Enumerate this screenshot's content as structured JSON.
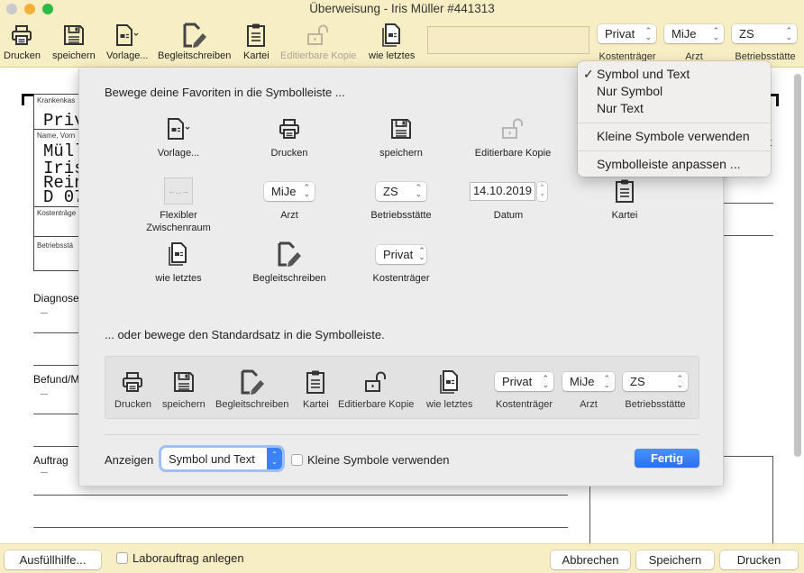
{
  "window": {
    "title": "Überweisung -  Iris Müller #441313"
  },
  "toolbar": {
    "items": [
      {
        "label": "Drucken",
        "icon": "printer-icon"
      },
      {
        "label": "speichern",
        "icon": "floppy-disk-icon"
      },
      {
        "label": "Vorlage...",
        "icon": "template-document-icon"
      },
      {
        "label": "Begleitschreiben",
        "icon": "document-edit-icon"
      },
      {
        "label": "Kartei",
        "icon": "clipboard-icon"
      },
      {
        "label": "Editierbare Kopie",
        "icon": "unlock-icon",
        "disabled": true
      },
      {
        "label": "wie letztes",
        "icon": "document-stack-icon"
      }
    ],
    "search_value": "",
    "popups": [
      {
        "value": "Privat",
        "label": "Kostenträger"
      },
      {
        "value": "MiJe",
        "label": "Arzt"
      },
      {
        "value": "ZS",
        "label": "Betriebsstätte"
      }
    ]
  },
  "document": {
    "field_labels": [
      "Krankenkas",
      "Name, Vorn",
      "Kostenträge",
      "Betriebsstä"
    ],
    "insurer": "Priv",
    "name_lines": [
      "Müll",
      "Iris",
      "Rein",
      "D 07"
    ],
    "sections": [
      "Diagnose",
      "Befund/M",
      "Auftrag"
    ],
    "right_partial": "t"
  },
  "sheet": {
    "heading_favorites": "Bewege deine Favoriten in die Symbolleiste ...",
    "favorites": [
      {
        "label": "Vorlage...",
        "icon": "template-document-icon"
      },
      {
        "label": "Drucken",
        "icon": "printer-icon"
      },
      {
        "label": "speichern",
        "icon": "floppy-disk-icon"
      },
      {
        "label": "Editierbare Kopie",
        "icon": "unlock-icon"
      },
      {
        "label": "Flexibler Zwischenraum",
        "icon": "flexible-space-icon"
      },
      {
        "label": "Arzt",
        "popup_value": "MiJe"
      },
      {
        "label": "Betriebsstätte",
        "popup_value": "ZS"
      },
      {
        "label": "Datum",
        "date_value": "14.10.2019"
      },
      {
        "label": "Kartei",
        "icon": "clipboard-icon"
      },
      {
        "label": "wie letztes",
        "icon": "document-stack-icon"
      },
      {
        "label": "Begleitschreiben",
        "icon": "document-edit-icon"
      },
      {
        "label": "Kostenträger",
        "popup_value": "Privat"
      }
    ],
    "heading_default": "... oder bewege den Standardsatz in die Symbolleiste.",
    "default_set": [
      {
        "label": "Drucken",
        "icon": "printer-icon"
      },
      {
        "label": "speichern",
        "icon": "floppy-disk-icon"
      },
      {
        "label": "Begleitschreiben",
        "icon": "document-edit-icon"
      },
      {
        "label": "Kartei",
        "icon": "clipboard-icon"
      },
      {
        "label": "Editierbare Kopie",
        "icon": "unlock-icon"
      },
      {
        "label": "wie letztes",
        "icon": "document-stack-icon"
      },
      {
        "label": "Kostenträger",
        "popup_value": "Privat"
      },
      {
        "label": "Arzt",
        "popup_value": "MiJe"
      },
      {
        "label": "Betriebsstätte",
        "popup_value": "ZS"
      }
    ],
    "show_label": "Anzeigen",
    "show_value": "Symbol und Text",
    "small_icons_label": "Kleine Symbole verwenden",
    "small_icons_checked": false,
    "done_label": "Fertig",
    "accent_color": "#3a82f7"
  },
  "context_menu": {
    "items": [
      {
        "label": "Symbol und Text",
        "checked": true
      },
      {
        "label": "Nur Symbol",
        "checked": false
      },
      {
        "label": "Nur Text",
        "checked": false
      },
      {
        "label": "Kleine Symbole verwenden",
        "checked": false
      },
      {
        "label": "Symbolleiste anpassen ...",
        "checked": false
      }
    ],
    "check_glyph": "✓"
  },
  "bottombar": {
    "fill_help": "Ausfüllhilfe...",
    "lab_order_label": "Laborauftrag anlegen",
    "lab_order_checked": false,
    "cancel": "Abbrechen",
    "save": "Speichern",
    "print": "Drucken"
  }
}
